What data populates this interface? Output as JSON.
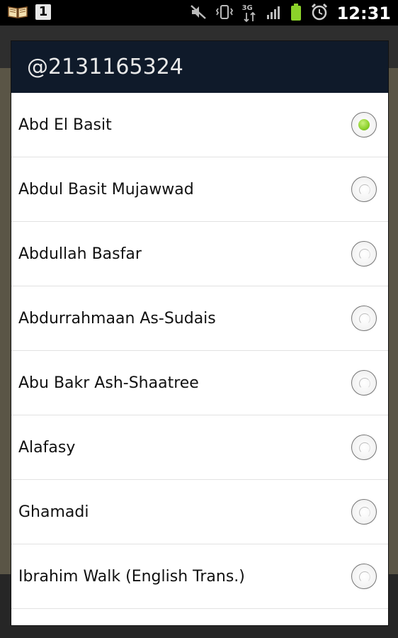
{
  "status_bar": {
    "left_icons": [
      "book-icon",
      "notification-one-icon"
    ],
    "one_badge": "1",
    "right_icons": [
      "mute-icon",
      "vibrate-icon",
      "data-3g-icon",
      "signal-icon",
      "battery-icon",
      "alarm-icon"
    ],
    "data_label": "3G",
    "time": "12:31"
  },
  "dialog": {
    "title": "@2131165324",
    "items": [
      {
        "label": "Abd El Basit",
        "checked": true
      },
      {
        "label": "Abdul Basit Mujawwad",
        "checked": false
      },
      {
        "label": "Abdullah Basfar",
        "checked": false
      },
      {
        "label": "Abdurrahmaan As-Sudais",
        "checked": false
      },
      {
        "label": "Abu Bakr Ash-Shaatree",
        "checked": false
      },
      {
        "label": "Alafasy",
        "checked": false
      },
      {
        "label": "Ghamadi",
        "checked": false
      },
      {
        "label": "Ibrahim Walk (English Trans.)",
        "checked": false
      }
    ]
  },
  "colors": {
    "dialog_header_bg": "#0f1a2a",
    "radio_selected": "#8bd12a"
  }
}
